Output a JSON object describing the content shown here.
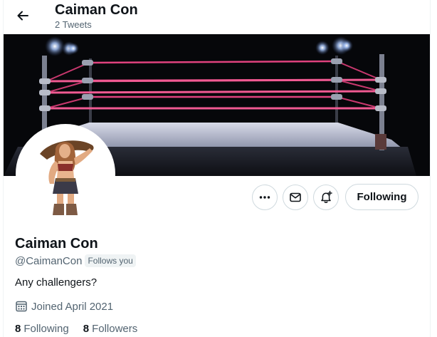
{
  "header": {
    "title": "Caiman Con",
    "subtitle": "2 Tweets"
  },
  "profile": {
    "name": "Caiman Con",
    "handle": "@CaimanCon",
    "follows_you_label": "Follows you",
    "bio": "Any challengers?",
    "joined": "Joined April 2021",
    "following_count": "8",
    "following_label": "Following",
    "followers_count": "8",
    "followers_label": "Followers"
  },
  "actions": {
    "more_icon": "more-horizontal-icon",
    "message_icon": "envelope-icon",
    "notify_icon": "bell-plus-icon",
    "follow_button_label": "Following"
  },
  "icons": {
    "back": "arrow-left-icon",
    "joined": "calendar-icon"
  },
  "colors": {
    "primary_text": "#0f1419",
    "secondary_text": "#536471",
    "border": "#cfd9de",
    "badge_bg": "#eff3f4",
    "ring_ropes": "#e0427e"
  }
}
